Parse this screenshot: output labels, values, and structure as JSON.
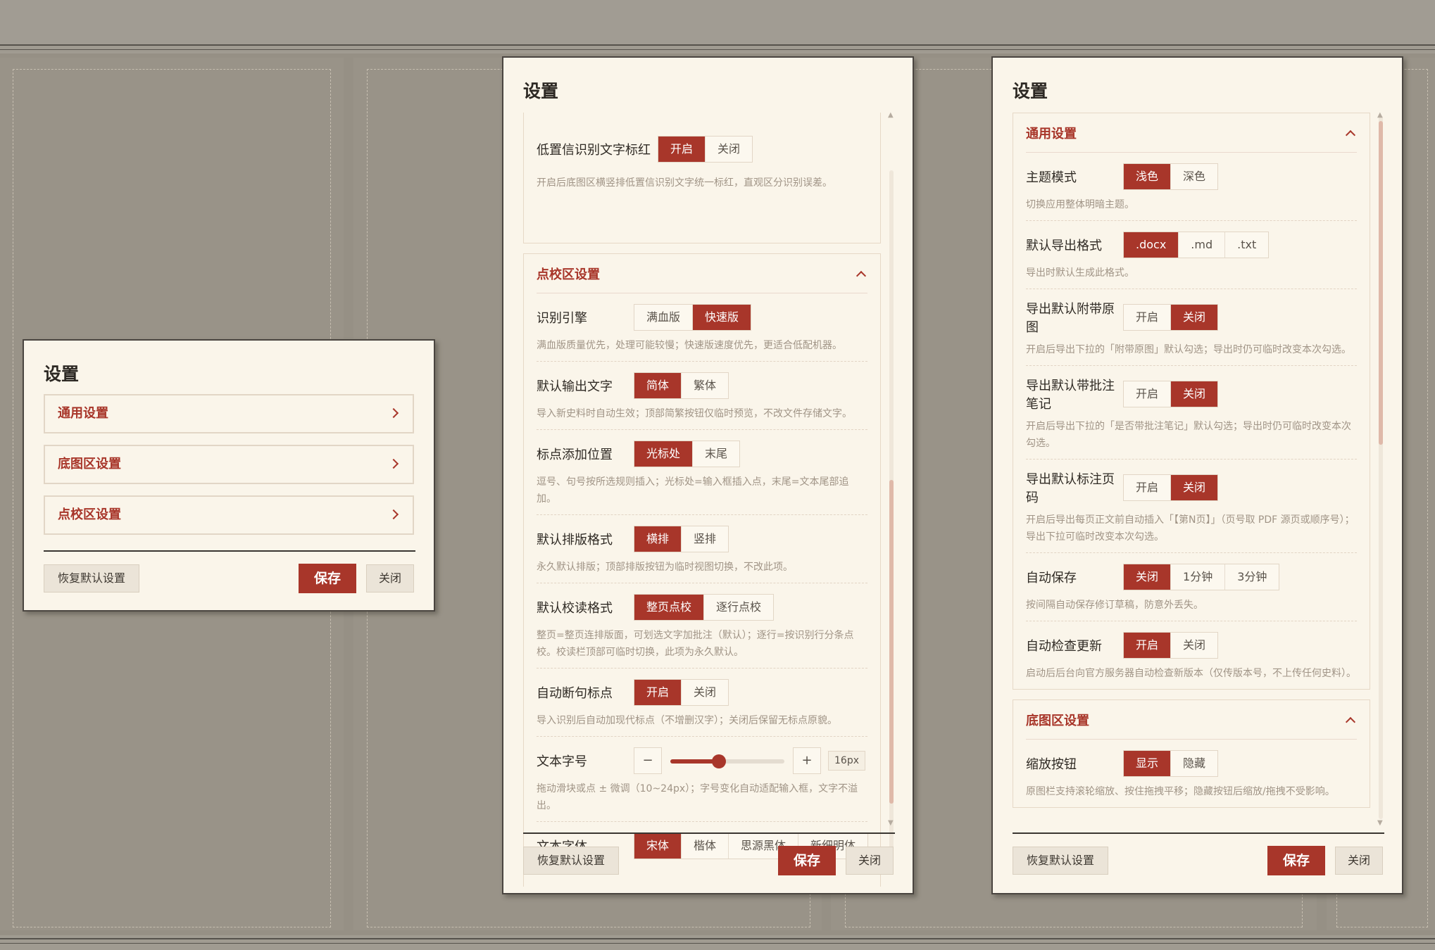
{
  "panel_a": {
    "title": "设置",
    "nav": [
      {
        "label": "通用设置"
      },
      {
        "label": "底图区设置"
      },
      {
        "label": "点校区设置"
      }
    ],
    "reset_label": "恢复默认设置",
    "save_label": "保存",
    "close_label": "关闭"
  },
  "panel_b": {
    "title": "设置",
    "top_item": {
      "label": "低置信识别文字标红",
      "options": [
        "开启",
        "关闭"
      ],
      "selected": 0,
      "desc": "开启后底图区横竖排低置信识别文字统一标红，直观区分识别误差。"
    },
    "section": {
      "title": "点校区设置",
      "items": [
        {
          "label": "识别引擎",
          "options": [
            "满血版",
            "快速版"
          ],
          "selected": 1,
          "desc": "满血版质量优先，处理可能较慢；快速版速度优先，更适合低配机器。"
        },
        {
          "label": "默认输出文字",
          "options": [
            "简体",
            "繁体"
          ],
          "selected": 0,
          "desc": "导入新史料时自动生效；顶部简繁按钮仅临时预览，不改文件存储文字。"
        },
        {
          "label": "标点添加位置",
          "options": [
            "光标处",
            "末尾"
          ],
          "selected": 0,
          "desc": "逗号、句号按所选规则插入；光标处=输入框插入点，末尾=文本尾部追加。"
        },
        {
          "label": "默认排版格式",
          "options": [
            "横排",
            "竖排"
          ],
          "selected": 0,
          "desc": "永久默认排版；顶部排版按钮为临时视图切换，不改此项。"
        },
        {
          "label": "默认校读格式",
          "options": [
            "整页点校",
            "逐行点校"
          ],
          "selected": 0,
          "desc": "整页=整页连排版面，可划选文字加批注（默认）；逐行=按识别行分条点校。校读栏顶部可临时切换，此项为永久默认。"
        },
        {
          "label": "自动断句标点",
          "options": [
            "开启",
            "关闭"
          ],
          "selected": 0,
          "desc": "导入识别后自动加现代标点（不增删汉字）；关闭后保留无标点原貌。"
        }
      ],
      "font_size": {
        "label": "文本字号",
        "minus": "−",
        "plus": "+",
        "value_text": "16px",
        "value": 16,
        "min": 10,
        "max": 24,
        "desc": "拖动滑块或点 ± 微调（10~24px）；字号变化自动适配输入框，文字不溢出。"
      },
      "font_family": {
        "label": "文本字体",
        "options": [
          "宋体",
          "楷体",
          "思源黑体",
          "新细明体"
        ],
        "selected": 0
      }
    },
    "reset_label": "恢复默认设置",
    "save_label": "保存",
    "close_label": "关闭"
  },
  "panel_c": {
    "title": "设置",
    "general": {
      "title": "通用设置",
      "items": [
        {
          "label": "主题模式",
          "options": [
            "浅色",
            "深色"
          ],
          "selected": 0,
          "desc": "切换应用整体明暗主题。"
        },
        {
          "label": "默认导出格式",
          "options": [
            ".docx",
            ".md",
            ".txt"
          ],
          "selected": 0,
          "desc": "导出时默认生成此格式。"
        },
        {
          "label": "导出默认附带原图",
          "options": [
            "开启",
            "关闭"
          ],
          "selected": 1,
          "desc": "开启后导出下拉的「附带原图」默认勾选；导出时仍可临时改变本次勾选。"
        },
        {
          "label": "导出默认带批注笔记",
          "options": [
            "开启",
            "关闭"
          ],
          "selected": 1,
          "desc": "开启后导出下拉的「是否带批注笔记」默认勾选；导出时仍可临时改变本次勾选。"
        },
        {
          "label": "导出默认标注页码",
          "options": [
            "开启",
            "关闭"
          ],
          "selected": 1,
          "desc": "开启后导出每页正文前自动插入「【第N页】」（页号取 PDF 源页或顺序号）；导出下拉可临时改变本次勾选。"
        },
        {
          "label": "自动保存",
          "options": [
            "关闭",
            "1分钟",
            "3分钟"
          ],
          "selected": 0,
          "desc": "按间隔自动保存修订草稿，防意外丢失。"
        },
        {
          "label": "自动检查更新",
          "options": [
            "开启",
            "关闭"
          ],
          "selected": 0,
          "desc": "启动后后台向官方服务器自动检查新版本（仅传版本号，不上传任何史料）。"
        }
      ]
    },
    "base": {
      "title": "底图区设置",
      "items": [
        {
          "label": "缩放按钮",
          "options": [
            "显示",
            "隐藏"
          ],
          "selected": 0,
          "desc": "原图栏支持滚轮缩放、按住拖拽平移；隐藏按钮后缩放/拖拽不受影响。"
        }
      ]
    },
    "reset_label": "恢复默认设置",
    "save_label": "保存",
    "close_label": "关闭"
  },
  "colors": {
    "accent": "#a8362a",
    "panel_bg": "#faf5ea",
    "backdrop": "#969085"
  }
}
